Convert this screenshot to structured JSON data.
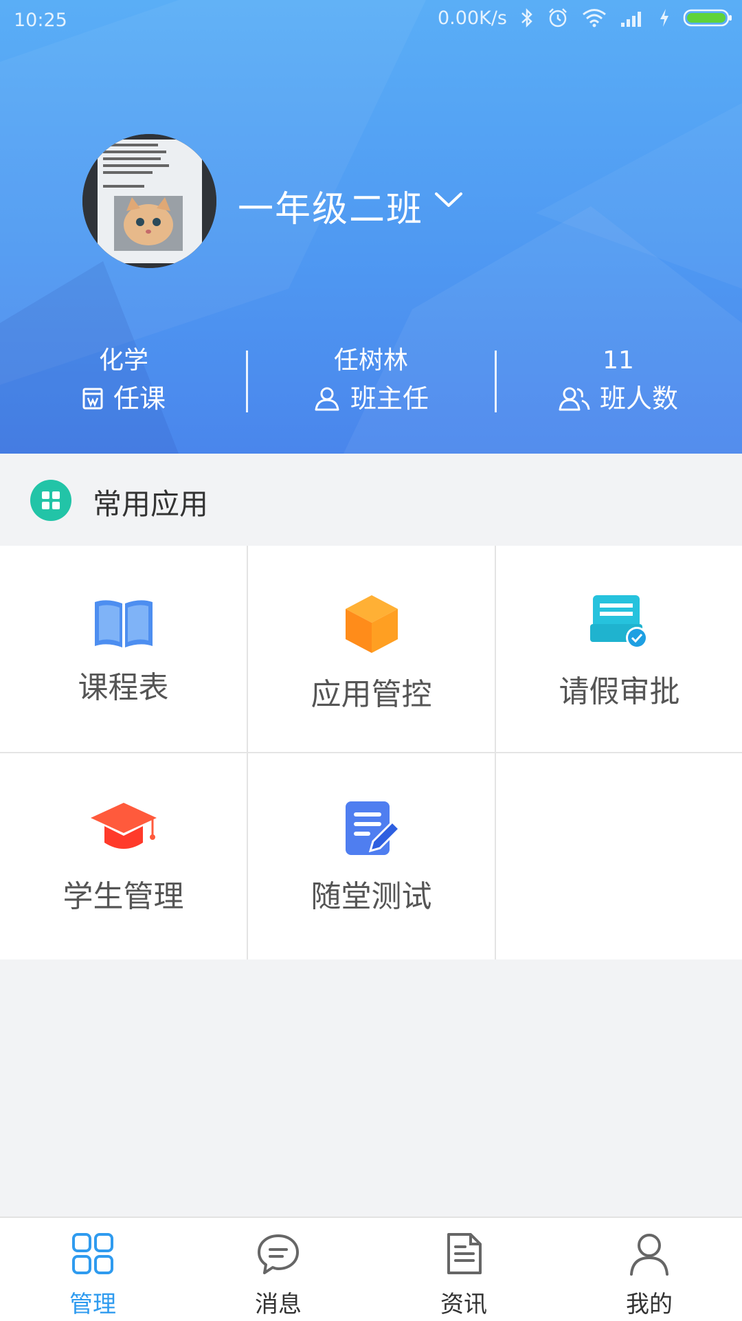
{
  "status_bar": {
    "time": "10:25",
    "net_speed": "0.00K/s"
  },
  "header": {
    "class_name": "一年级二班"
  },
  "stats": [
    {
      "value": "化学",
      "label": "任课",
      "icon": "book-frame-icon"
    },
    {
      "value": "任树林",
      "label": "班主任",
      "icon": "person-icon"
    },
    {
      "value": "11",
      "label": "班人数",
      "icon": "people-icon"
    }
  ],
  "section": {
    "title": "常用应用"
  },
  "apps": [
    {
      "label": "课程表",
      "icon": "open-book-icon"
    },
    {
      "label": "应用管控",
      "icon": "cube-icon"
    },
    {
      "label": "请假审批",
      "icon": "approval-icon"
    },
    {
      "label": "学生管理",
      "icon": "graduation-cap-icon"
    },
    {
      "label": "随堂测试",
      "icon": "document-pen-icon"
    }
  ],
  "tabs": [
    {
      "label": "管理",
      "icon": "grid-icon",
      "active": true
    },
    {
      "label": "消息",
      "icon": "chat-icon",
      "active": false
    },
    {
      "label": "资讯",
      "icon": "news-icon",
      "active": false
    },
    {
      "label": "我的",
      "icon": "user-icon",
      "active": false
    }
  ],
  "colors": {
    "accent": "#2f9bef",
    "header_top": "#5aaef6",
    "header_bottom": "#4a86ec",
    "section_icon": "#22c4a7"
  }
}
